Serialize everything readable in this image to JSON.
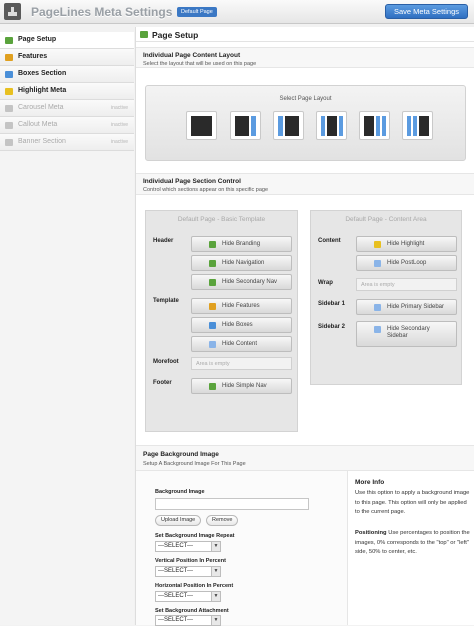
{
  "header": {
    "title": "PageLines Meta Settings",
    "badge": "Default Page",
    "save_label": "Save Meta Settings"
  },
  "sidebar": {
    "items": [
      {
        "label": "Page Setup",
        "icon": "layout-icon",
        "color": "#5aa33c",
        "active": true,
        "inactive_tag": ""
      },
      {
        "label": "Features",
        "icon": "features-icon",
        "color": "#e0a020",
        "active": false,
        "inactive_tag": ""
      },
      {
        "label": "Boxes Section",
        "icon": "boxes-icon",
        "color": "#4a8fd8",
        "active": false,
        "inactive_tag": ""
      },
      {
        "label": "Highlight Meta",
        "icon": "highlight-icon",
        "color": "#e8c020",
        "active": false,
        "inactive_tag": ""
      },
      {
        "label": "Carousel Meta",
        "icon": "carousel-icon",
        "color": "#999999",
        "active": false,
        "inactive_tag": "inactive"
      },
      {
        "label": "Callout Meta",
        "icon": "callout-icon",
        "color": "#999999",
        "active": false,
        "inactive_tag": "inactive"
      },
      {
        "label": "Banner Section",
        "icon": "banner-icon",
        "color": "#999999",
        "active": false,
        "inactive_tag": "inactive"
      }
    ]
  },
  "main": {
    "section_title": "Page Setup",
    "layout": {
      "title": "Individual Page Content Layout",
      "desc": "Select the layout that will be used on this page",
      "box_label": "Select Page Layout",
      "options": [
        "full-width",
        "one-sidebar-right",
        "one-sidebar-left",
        "two-sidebar-center",
        "two-sidebar-right",
        "two-sidebar-left"
      ]
    },
    "control": {
      "title": "Individual Page Section Control",
      "desc": "Control which sections appear on this specific page"
    },
    "left_panel": {
      "title": "Default Page - Basic Template",
      "header_label": "Header",
      "template_label": "Template",
      "morefoot_label": "Morefoot",
      "footer_label": "Footer",
      "morefoot_empty": "Area is empty",
      "buttons": [
        "Hide Branding",
        "Hide Navigation",
        "Hide Secondary Nav",
        "Hide Features",
        "Hide Boxes",
        "Hide Content",
        "Hide Simple Nav"
      ]
    },
    "right_panel": {
      "title": "Default Page - Content Area",
      "content_label": "Content",
      "wrap_label": "Wrap",
      "sidebar1_label": "Sidebar 1",
      "sidebar2_label": "Sidebar 2",
      "wrap_empty": "Area is empty",
      "buttons": [
        "Hide Highlight",
        "Hide PostLoop",
        "Hide Primary Sidebar",
        "Hide Secondary Sidebar"
      ]
    },
    "bg": {
      "title": "Page Background Image",
      "desc": "Setup A Background Image For This Page",
      "image_label": "Background Image",
      "upload_label": "Upload Image",
      "remove_label": "Remove",
      "repeat_label": "Set Background Image Repeat",
      "repeat_value": "---SELECT---",
      "vpos_label": "Vertical Position In Percent",
      "vpos_value": "---SELECT---",
      "hpos_label": "Horizontal Position In Percent",
      "hpos_value": "---SELECT---",
      "attach_label": "Set Background Attachment",
      "attach_value": "---SELECT---"
    },
    "info": {
      "title": "More Info",
      "text": "Use this option to apply a background image to this page. This option will only be applied to the current page.",
      "pos_title": "Positioning",
      "pos_text": "Use percentages to position the images, 0% corresponds to the \"top\" or \"left\" side, 50% to center, etc."
    }
  }
}
